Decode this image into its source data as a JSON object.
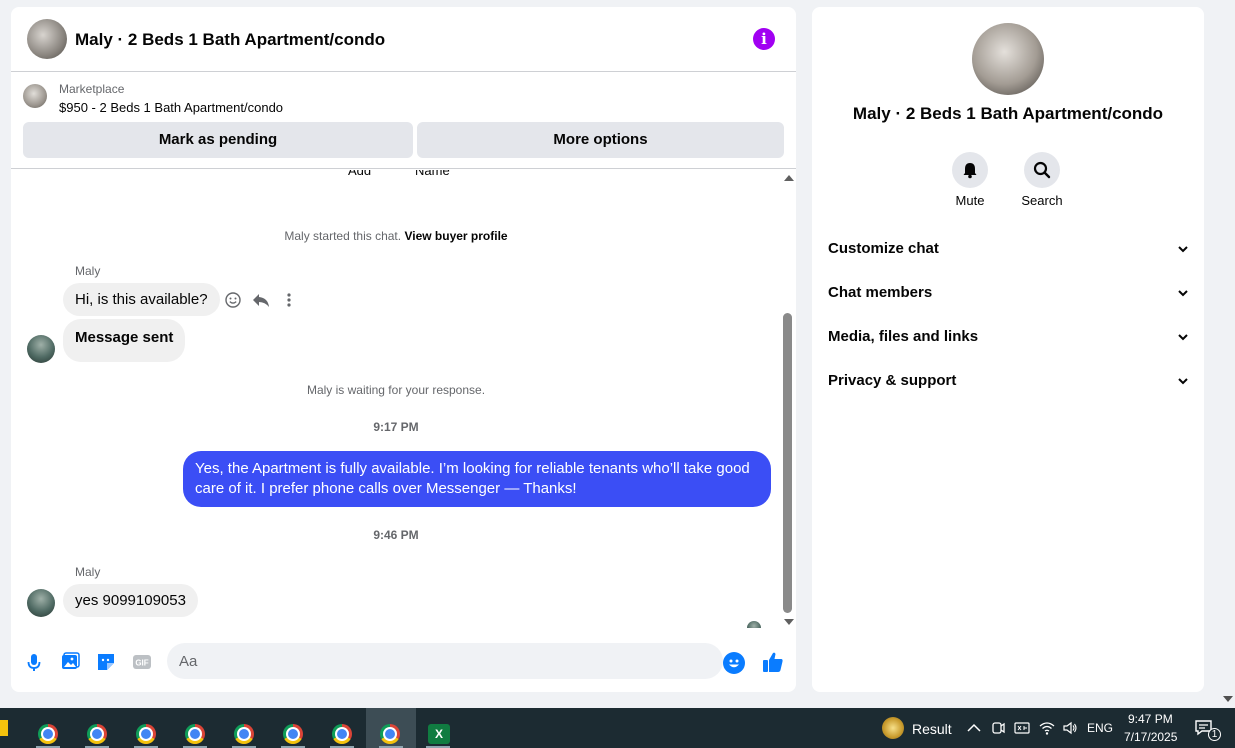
{
  "chat": {
    "title": "Maly · 2 Beds 1 Bath Apartment/condo",
    "info_icon": "info-icon",
    "listing": {
      "label": "Marketplace",
      "item": "$950 - 2 Beds 1 Bath Apartment/condo",
      "mark_pending": "Mark as pending",
      "more_options": "More options"
    },
    "partial_labels": [
      "Add",
      "Name"
    ],
    "started": {
      "text": "Maly started this chat.",
      "link": "View buyer profile"
    },
    "messages": [
      {
        "sender": "Maly",
        "text": "Hi, is this available?"
      },
      {
        "text": "Message sent"
      }
    ],
    "waiting": "Maly is waiting for your response.",
    "time1": "9:17 PM",
    "outgoing": "Yes, the Apartment is fully available. I’m looking for reliable tenants who’ll take good care of it. I prefer phone calls over Messenger —  Thanks!",
    "time2": "9:46 PM",
    "reply": {
      "sender": "Maly",
      "text": "yes 9099109053"
    },
    "composer": {
      "placeholder": "Aa"
    }
  },
  "info_panel": {
    "title": "Maly · 2 Beds 1 Bath Apartment/condo",
    "mute": "Mute",
    "search": "Search",
    "sections": [
      "Customize chat",
      "Chat members",
      "Media, files and links",
      "Privacy & support"
    ]
  },
  "taskbar": {
    "weather_label": "Result",
    "language": "ENG",
    "time": "9:47 PM",
    "date": "7/17/2025",
    "notification_count": "1"
  },
  "colors": {
    "accent": "#3b4ef5",
    "info": "#a100f2",
    "messenger_blue": "#0a7cff"
  }
}
